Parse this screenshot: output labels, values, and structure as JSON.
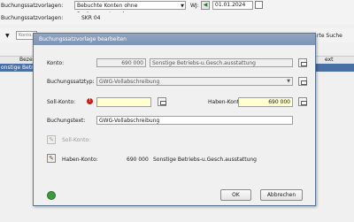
{
  "background": {
    "row1_label": "Buchungssatzvorlagen:",
    "row1_combo": "Bebuchte Konten ohne Buchungssatzvorlagen",
    "wj_label": "WJ:",
    "wj_value": "01.01.2024",
    "row2_label": "Buchungssatzvorlagen:",
    "row2_value": "SKR 04",
    "search_placeholder": "Konto..",
    "right_link": "rte Suche",
    "col_left": "Bezei",
    "col_right": "ext",
    "row_text": "onstige Betriebs-u"
  },
  "dialog": {
    "title": "Buchungssatzvorlage bearbeiten",
    "konto_label": "Konto:",
    "konto_number": "690 000",
    "konto_name": "Sonstige Betriebs-u.Gesch.ausstattung",
    "buchungssatztyp_label": "Buchungssatztyp:",
    "buchungssatztyp_value": "GWG-Vollabschreibung",
    "soll_label": "Soll-Konto:",
    "soll_value": "",
    "haben_label": "Haben-Konto:",
    "haben_value": "690 000",
    "buchungstext_label": "Buchungstext:",
    "buchungstext_value": "GWG-Vollabschreibung",
    "soll_row_label": "Soll-Konto:",
    "haben_row_label": "Haben-Konto:",
    "haben_row_number": "690 000",
    "haben_row_name": "Sonstige Betriebs-u.Gesch.ausstattung",
    "ok_label": "OK",
    "cancel_label": "Abbrechen"
  }
}
